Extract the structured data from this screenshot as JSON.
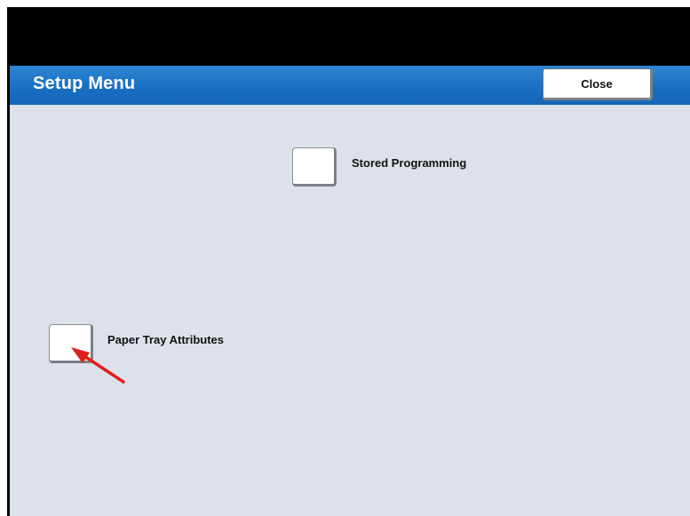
{
  "header": {
    "title": "Setup Menu",
    "close_label": "Close"
  },
  "options": [
    {
      "label": "Stored Programming"
    },
    {
      "label": "Paper Tray Attributes"
    }
  ],
  "colors": {
    "title_bar": "#1a6fc2",
    "content_background": "#dde2ea",
    "top_band": "#000000",
    "annotation_arrow": "#e0201a"
  }
}
